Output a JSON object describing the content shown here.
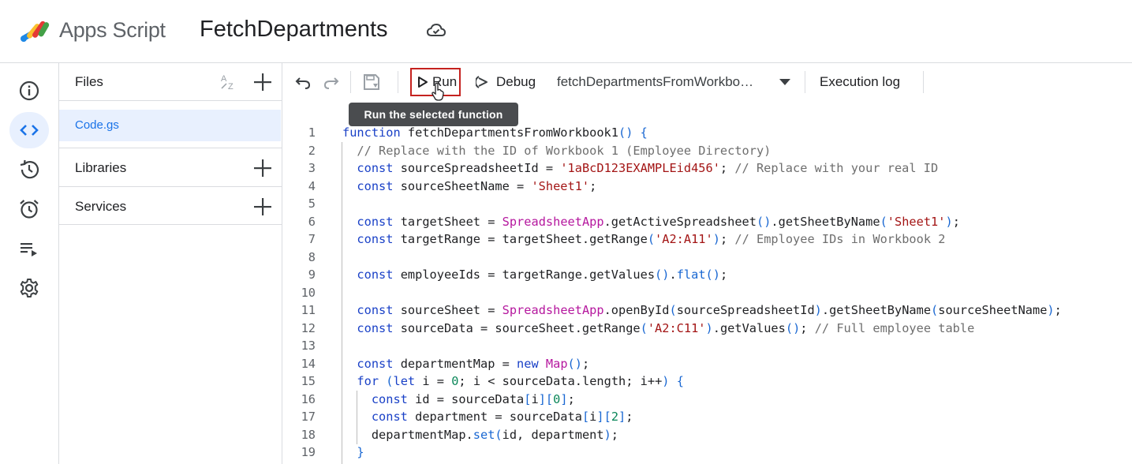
{
  "header": {
    "app_name": "Apps Script",
    "project_name": "FetchDepartments"
  },
  "rail": {
    "items": [
      "overview-icon",
      "editor-icon",
      "history-icon",
      "triggers-icon",
      "executions-icon",
      "settings-icon"
    ],
    "active": "editor-icon"
  },
  "files_panel": {
    "title": "Files",
    "files": [
      {
        "name": "Code.gs",
        "selected": true
      }
    ],
    "libraries_label": "Libraries",
    "services_label": "Services"
  },
  "toolbar": {
    "run_label": "Run",
    "debug_label": "Debug",
    "selected_function": "fetchDepartmentsFromWorkbo…",
    "execution_log_label": "Execution log",
    "tooltip": "Run the selected function"
  },
  "editor": {
    "lines": [
      {
        "n": "1",
        "code": "function fetchDepartmentsFromWorkbook1() {"
      },
      {
        "n": "2",
        "code": "  // Replace with the ID of Workbook 1 (Employee Directory)"
      },
      {
        "n": "3",
        "code": "  const sourceSpreadsheetId = '1aBcD123EXAMPLEid456'; // Replace with your real ID"
      },
      {
        "n": "4",
        "code": "  const sourceSheetName = 'Sheet1';"
      },
      {
        "n": "5",
        "code": ""
      },
      {
        "n": "6",
        "code": "  const targetSheet = SpreadsheetApp.getActiveSpreadsheet().getSheetByName('Sheet1');"
      },
      {
        "n": "7",
        "code": "  const targetRange = targetSheet.getRange('A2:A11'); // Employee IDs in Workbook 2"
      },
      {
        "n": "8",
        "code": ""
      },
      {
        "n": "9",
        "code": "  const employeeIds = targetRange.getValues().flat();"
      },
      {
        "n": "10",
        "code": ""
      },
      {
        "n": "11",
        "code": "  const sourceSheet = SpreadsheetApp.openById(sourceSpreadsheetId).getSheetByName(sourceSheetName);"
      },
      {
        "n": "12",
        "code": "  const sourceData = sourceSheet.getRange('A2:C11').getValues(); // Full employee table"
      },
      {
        "n": "13",
        "code": ""
      },
      {
        "n": "14",
        "code": "  const departmentMap = new Map();"
      },
      {
        "n": "15",
        "code": "  for (let i = 0; i < sourceData.length; i++) {"
      },
      {
        "n": "16",
        "code": "    const id = sourceData[i][0];"
      },
      {
        "n": "17",
        "code": "    const department = sourceData[i][2];"
      },
      {
        "n": "18",
        "code": "    departmentMap.set(id, department);"
      },
      {
        "n": "19",
        "code": "  }"
      }
    ]
  },
  "colors": {
    "accent": "#1a73e8",
    "run_highlight": "#c5221f",
    "tooltip_bg": "#4a4c4f"
  }
}
